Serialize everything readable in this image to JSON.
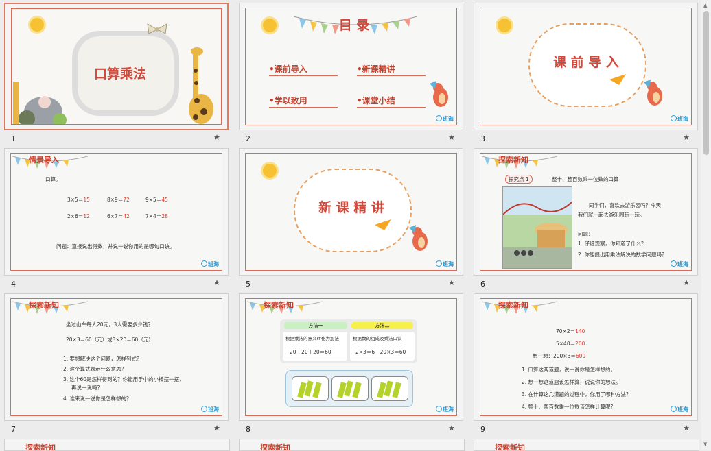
{
  "slides": [
    {
      "num": "1",
      "title": "口算乘法"
    },
    {
      "num": "2",
      "title": "目 录",
      "toc": [
        "•课前导入",
        "•新课精讲",
        "•学以致用",
        "•课堂小结"
      ]
    },
    {
      "num": "3",
      "title": "课 前 导 入"
    },
    {
      "num": "4",
      "section": "情景导入",
      "intro": "口算。",
      "problems": [
        [
          "3×5＝",
          "15"
        ],
        [
          "8×9＝",
          "72"
        ],
        [
          "9×5＝",
          "45"
        ],
        [
          "2×6＝",
          "12"
        ],
        [
          "6×7＝",
          "42"
        ],
        [
          "7×4＝",
          "28"
        ]
      ],
      "question": "问题：直接说出得数，并说一说你用的是哪句口诀。"
    },
    {
      "num": "5",
      "title": "新 课 精 讲"
    },
    {
      "num": "6",
      "section": "探索新知",
      "tag": "探究点 1",
      "topic": "整十、整百数乘一位数的口算",
      "text1": "同学们，喜欢去游乐园吗？今天",
      "text2": "我们就一起去游乐园玩一玩。",
      "qhead": "问题：",
      "q1": "1. 仔细观察，你知道了什么？",
      "q2": "2. 你能提出用乘法解决的数学问题吗？"
    },
    {
      "num": "7",
      "section": "探索新知",
      "line1": "坐过山车每人20元，3人需要多少钱？",
      "line2": "20×3＝60（元）或3×20＝60（元）",
      "qs": [
        "1. 要想解决这个问题，怎样列式？",
        "2. 这个算式表示什么意思？",
        "3. 这个60是怎样得到的？你能用手中的小棒摆一摆，",
        "再说一说吗？",
        "4. 谁来说一说你是怎样想的？"
      ]
    },
    {
      "num": "8",
      "section": "探索新知",
      "m1": "方法一",
      "m1desc": "根据乘法的意义转化为加法",
      "m1eq": "20＋20＋20＝60",
      "m2": "方法二",
      "m2desc": "根据数的组成及乘法口诀",
      "m2eq": "2×3＝6　20×3＝60"
    },
    {
      "num": "9",
      "section": "探索新知",
      "e1": [
        "70×2＝",
        "140"
      ],
      "e2": [
        "5×40＝",
        "200"
      ],
      "e3": [
        "想一想：200×3＝",
        "600"
      ],
      "qs": [
        "1. 口算这两道题，说一说你是怎样想的。",
        "2. 想一想这道题该怎样算，说说你的想法。",
        "3. 在计算这几道题的过程中，你用了哪种方法？",
        "4. 整十、整百数乘一位数该怎样计算呢？"
      ]
    }
  ],
  "brand": "班海",
  "star_icon": "★",
  "partial_section": "探索新知",
  "accent": "#d96a55"
}
